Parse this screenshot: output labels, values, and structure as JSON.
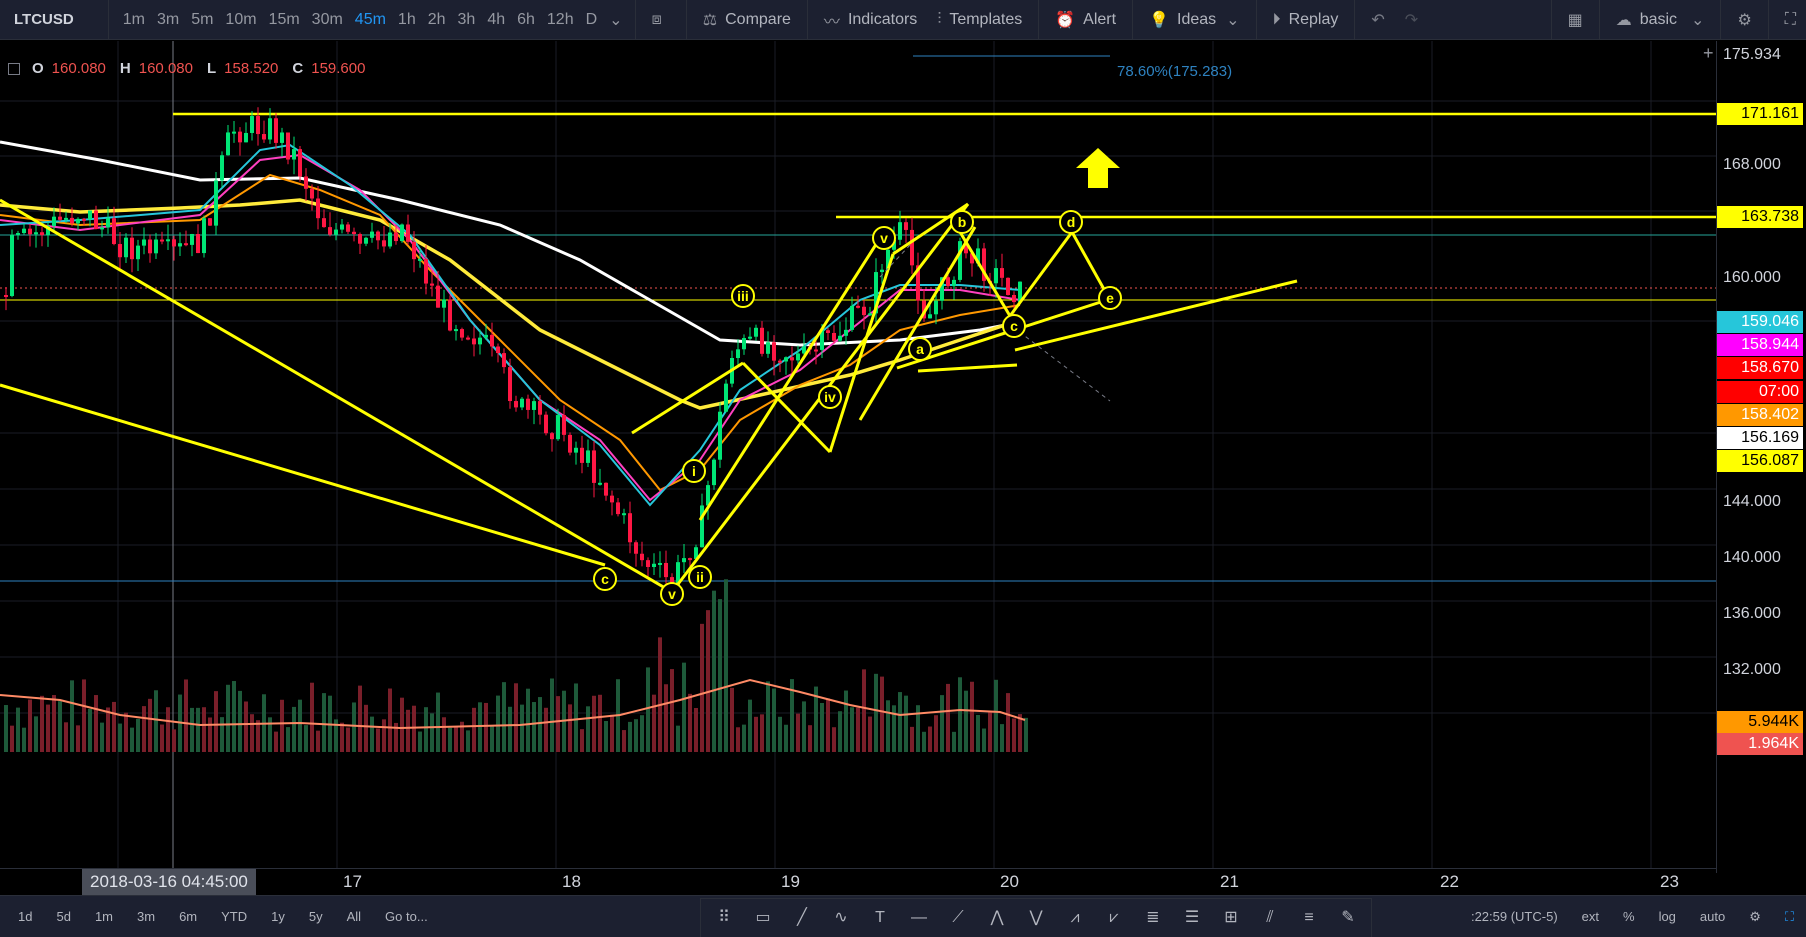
{
  "toolbar": {
    "symbol": "LTCUSD",
    "intervals": [
      "1m",
      "3m",
      "5m",
      "10m",
      "15m",
      "30m",
      "45m",
      "1h",
      "2h",
      "3h",
      "4h",
      "6h",
      "12h",
      "D"
    ],
    "active_interval": "45m",
    "compare": "Compare",
    "indicators": "Indicators",
    "templates": "Templates",
    "alert": "Alert",
    "ideas": "Ideas",
    "replay": "Replay",
    "layout": "basic"
  },
  "legend": {
    "o_label": "O",
    "o_value": "160.080",
    "h_label": "H",
    "h_value": "160.080",
    "l_label": "L",
    "l_value": "158.520",
    "c_label": "C",
    "c_value": "159.600"
  },
  "fib_label": "78.60%(175.283)",
  "price_axis": {
    "ticks": [
      "175.934",
      "172.000",
      "168.000",
      "160.000",
      "148.000",
      "144.000",
      "140.000",
      "136.000",
      "132.000"
    ],
    "badges": [
      {
        "text": "171.161",
        "bg": "#ffff00",
        "fg": "#000000"
      },
      {
        "text": "163.738",
        "bg": "#ffff00",
        "fg": "#000000"
      },
      {
        "text": "159.046",
        "bg": "#26c6da",
        "fg": "#ffffff"
      },
      {
        "text": "158.944",
        "bg": "#ff00ff",
        "fg": "#ffffff"
      },
      {
        "text": "158.670",
        "bg": "#ff0000",
        "fg": "#ffffff"
      },
      {
        "text": "07:00",
        "bg": "#ff0000",
        "fg": "#ffffff"
      },
      {
        "text": "158.402",
        "bg": "#ff9800",
        "fg": "#ffffff"
      },
      {
        "text": "156.169",
        "bg": "#ffffff",
        "fg": "#000000"
      },
      {
        "text": "156.087",
        "bg": "#ffff00",
        "fg": "#000000"
      },
      {
        "text": "5.944K",
        "bg": "#ff9800",
        "fg": "#000000"
      },
      {
        "text": "1.964K",
        "bg": "#ef5350",
        "fg": "#ffffff"
      }
    ]
  },
  "time_axis": {
    "cursor": "2018-03-16 04:45:00",
    "ticks": [
      "17",
      "18",
      "19",
      "20",
      "21",
      "22",
      "23"
    ]
  },
  "wave_labels": [
    "v",
    "iii",
    "iv",
    "i",
    "ii",
    "v",
    "c",
    "a",
    "b",
    "c",
    "d",
    "e"
  ],
  "bottom": {
    "ranges": [
      "1d",
      "5d",
      "1m",
      "3m",
      "6m",
      "YTD",
      "1y",
      "5y",
      "All"
    ],
    "goto": "Go to...",
    "clock": ":22:59 (UTC-5)",
    "ext": "ext",
    "pct": "%",
    "log": "log",
    "auto": "auto"
  },
  "colors": {
    "yellow": "#ffff00",
    "bull": "#00e676",
    "bear": "#ff1744",
    "ma_white": "#ffffff",
    "ma_orange": "#ff9800",
    "ma_pink": "#ff40c0",
    "ma_cyan": "#26c6da",
    "ma_yellow": "#ffeb3b"
  }
}
